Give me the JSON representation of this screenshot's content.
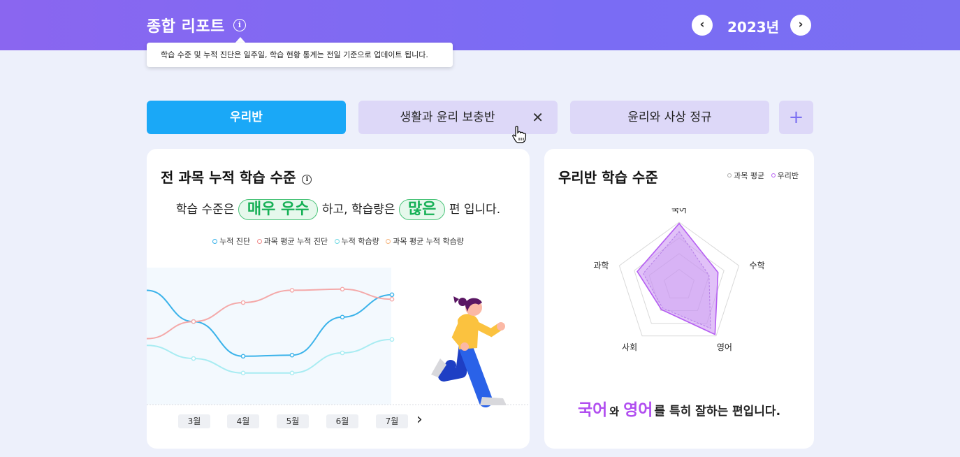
{
  "header": {
    "title": "종합 리포트",
    "info_icon": "ⓘ",
    "tooltip": "학습 수준 및 누적 진단은 일주일, 학습 현황 통계는 전일 기준으로 업데이트 됩니다.",
    "year": "2023년",
    "prev_icon": "‹",
    "next_icon": "›"
  },
  "tabs": [
    {
      "label": "우리반",
      "active": true
    },
    {
      "label": "생활과 윤리 보충반",
      "closable": true
    },
    {
      "label": "윤리와 사상 정규"
    }
  ],
  "tab_close_icon": "✕",
  "add_tab_icon": "+",
  "left_card": {
    "title": "전 과목 누적 학습 수준",
    "info_icon": "ⓘ",
    "summary_prefix": "학습 수준은",
    "level": "매우 우수",
    "summary_mid": "하고, 학습량은",
    "amount": "많은",
    "summary_suffix": "편 입니다.",
    "months": [
      "3월",
      "4월",
      "5월",
      "6월",
      "7월"
    ],
    "next_icon": "›"
  },
  "right_card": {
    "title": "우리반 학습 수준",
    "legend": [
      "과목 평균",
      "우리반"
    ],
    "msg_subject1": "국어",
    "msg_connector": "와",
    "msg_subject2": "영어",
    "msg_suffix": "를 특히 잘하는 편입니다."
  },
  "chart_data": [
    {
      "type": "line",
      "categories": [
        "3월",
        "4월",
        "5월",
        "6월",
        "7월"
      ],
      "series": [
        {
          "name": "누적 진단",
          "color": "#3bb3ea",
          "values": [
            0.58,
            0.27,
            0.28,
            0.62,
            0.82
          ]
        },
        {
          "name": "과목 평균 누적 진단",
          "color": "#f4a9a9",
          "values": [
            0.58,
            0.75,
            0.86,
            0.87,
            0.78
          ]
        },
        {
          "name": "누적 학습량",
          "color": "#a8ecf2",
          "values": [
            0.25,
            0.12,
            0.12,
            0.3,
            0.42
          ]
        },
        {
          "name": "과목 평균 누적 학습량",
          "color": "#f5b37a",
          "values": []
        }
      ]
    },
    {
      "type": "radar",
      "categories": [
        "국어",
        "수학",
        "영어",
        "사회",
        "과학"
      ],
      "series": [
        {
          "name": "과목 평균",
          "color": "#9b6cd8",
          "values": [
            0.85,
            0.5,
            0.85,
            0.45,
            0.6
          ]
        },
        {
          "name": "우리반",
          "color": "#b55ef2",
          "values": [
            0.98,
            0.65,
            0.97,
            0.48,
            0.7
          ]
        }
      ],
      "ylim": [
        0,
        1
      ]
    }
  ]
}
